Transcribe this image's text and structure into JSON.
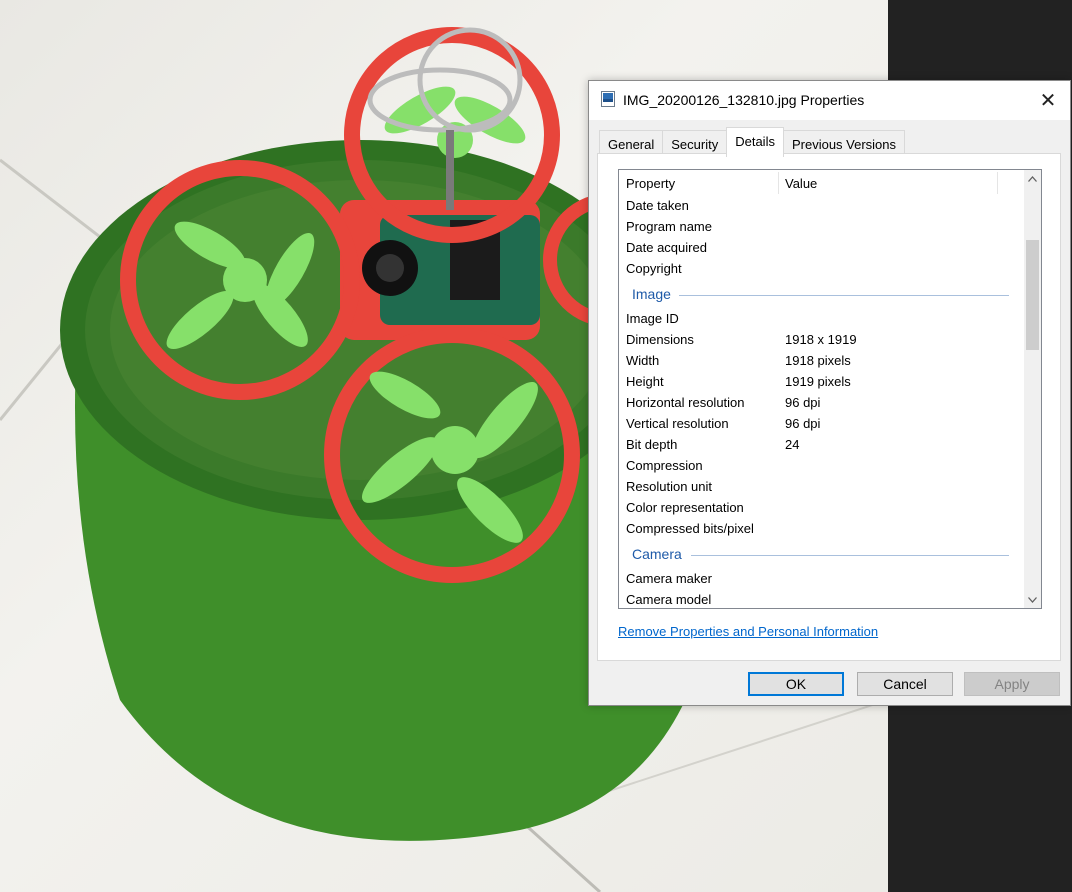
{
  "window": {
    "title": "IMG_20200126_132810.jpg Properties",
    "close_glyph": "✕"
  },
  "tabs": [
    {
      "label": "General"
    },
    {
      "label": "Security"
    },
    {
      "label": "Details",
      "active": true
    },
    {
      "label": "Previous Versions"
    }
  ],
  "details": {
    "header_property": "Property",
    "header_value": "Value",
    "rows_top": [
      {
        "key": "Date taken",
        "value": ""
      },
      {
        "key": "Program name",
        "value": ""
      },
      {
        "key": "Date acquired",
        "value": ""
      },
      {
        "key": "Copyright",
        "value": ""
      }
    ],
    "group_image": "Image",
    "rows_image": [
      {
        "key": "Image ID",
        "value": ""
      },
      {
        "key": "Dimensions",
        "value": "1918 x 1919"
      },
      {
        "key": "Width",
        "value": "1918 pixels"
      },
      {
        "key": "Height",
        "value": "1919 pixels"
      },
      {
        "key": "Horizontal resolution",
        "value": "96 dpi"
      },
      {
        "key": "Vertical resolution",
        "value": "96 dpi"
      },
      {
        "key": "Bit depth",
        "value": "24"
      },
      {
        "key": "Compression",
        "value": ""
      },
      {
        "key": "Resolution unit",
        "value": ""
      },
      {
        "key": "Color representation",
        "value": ""
      },
      {
        "key": "Compressed bits/pixel",
        "value": ""
      }
    ],
    "group_camera": "Camera",
    "rows_camera": [
      {
        "key": "Camera maker",
        "value": ""
      },
      {
        "key": "Camera model",
        "value": ""
      }
    ]
  },
  "remove_link": "Remove Properties and Personal Information",
  "buttons": {
    "ok": "OK",
    "cancel": "Cancel",
    "apply": "Apply"
  },
  "colors": {
    "accent": "#0078d7",
    "group_header": "#1e5aa8",
    "link": "#0066cc"
  }
}
